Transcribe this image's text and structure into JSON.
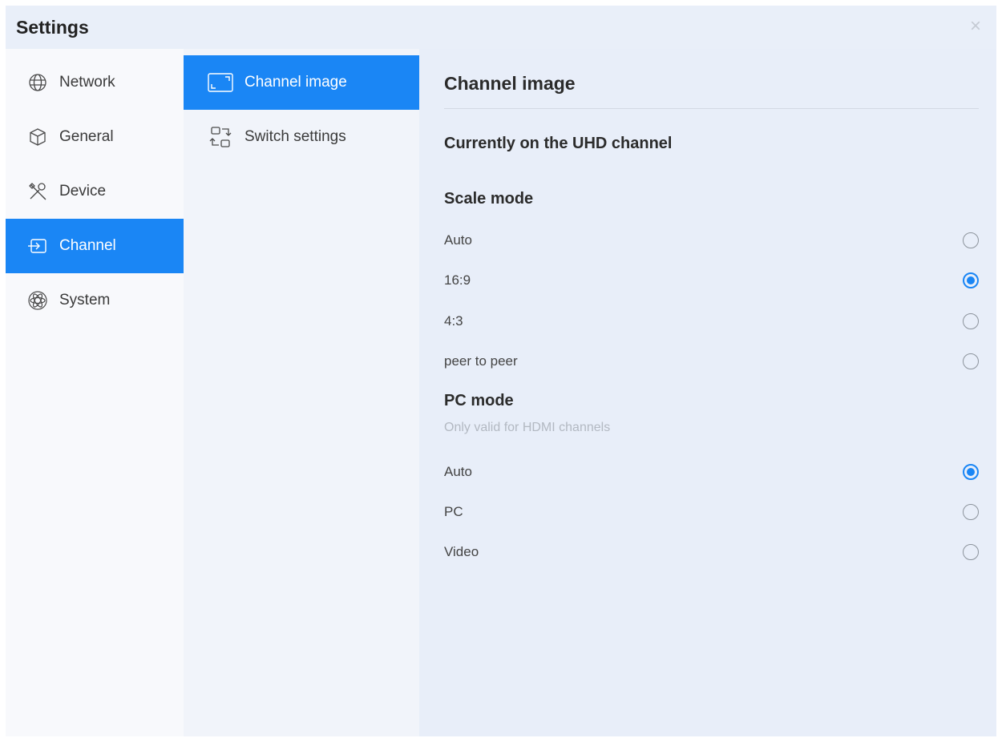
{
  "window": {
    "title": "Settings",
    "close_glyph": "×"
  },
  "colors": {
    "accent": "#1a86f5"
  },
  "nav": {
    "items": [
      {
        "label": "Network",
        "icon": "globe-icon",
        "active": false
      },
      {
        "label": "General",
        "icon": "cube-icon",
        "active": false
      },
      {
        "label": "Device",
        "icon": "tools-icon",
        "active": false
      },
      {
        "label": "Channel",
        "icon": "input-icon",
        "active": true
      },
      {
        "label": "System",
        "icon": "atom-icon",
        "active": false
      }
    ]
  },
  "subnav": {
    "items": [
      {
        "label": "Channel image",
        "icon": "frame-icon",
        "active": true
      },
      {
        "label": "Switch settings",
        "icon": "switch-icon",
        "active": false
      }
    ]
  },
  "content": {
    "title": "Channel image",
    "current_channel": "Currently on the UHD channel",
    "scale_mode": {
      "heading": "Scale mode",
      "options": [
        {
          "label": "Auto",
          "selected": false
        },
        {
          "label": "16:9",
          "selected": true
        },
        {
          "label": "4:3",
          "selected": false
        },
        {
          "label": "peer to peer",
          "selected": false
        }
      ]
    },
    "pc_mode": {
      "heading": "PC mode",
      "hint": "Only valid for HDMI channels",
      "options": [
        {
          "label": "Auto",
          "selected": true
        },
        {
          "label": "PC",
          "selected": false
        },
        {
          "label": "Video",
          "selected": false
        }
      ]
    }
  }
}
